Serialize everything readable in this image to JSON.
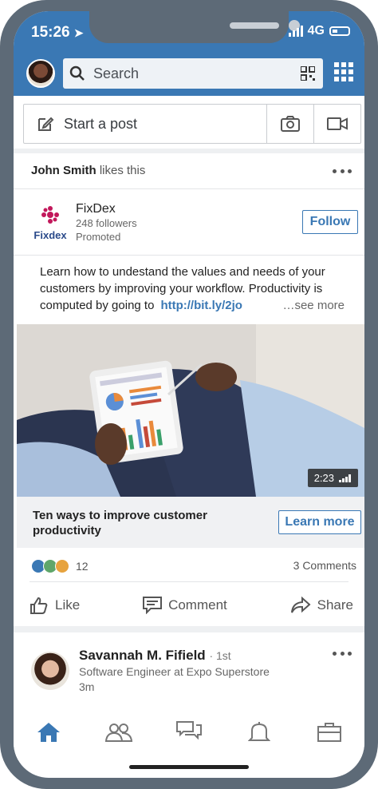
{
  "status_bar": {
    "time": "15:26",
    "network": "4G"
  },
  "header": {
    "search_placeholder": "Search"
  },
  "composer": {
    "start_post": "Start a post"
  },
  "post": {
    "social_context_name": "John Smith",
    "social_context_action": "likes this",
    "company": {
      "name": "FixDex",
      "logo_text": "Fixdex",
      "followers": "248 followers",
      "promoted": "Promoted"
    },
    "follow_label": "Follow",
    "text": "Learn how to undestand the values and needs of your customers by improving your workflow. Productivity is computed by going to",
    "link": "http://bit.ly/2jo",
    "see_more": "…see more",
    "video_duration": "2:23",
    "cta_title": "Ten ways to improve customer productivity",
    "cta_button": "Learn more",
    "reaction_count": "12",
    "comments": "3 Comments",
    "actions": {
      "like": "Like",
      "comment": "Comment",
      "share": "Share"
    }
  },
  "next_post": {
    "name": "Savannah M. Fifield",
    "degree": "· 1st",
    "title": "Software Engineer at Expo Superstore",
    "time": "3m"
  },
  "colors": {
    "brand": "#3a78b4",
    "frame": "#5d6a77"
  }
}
